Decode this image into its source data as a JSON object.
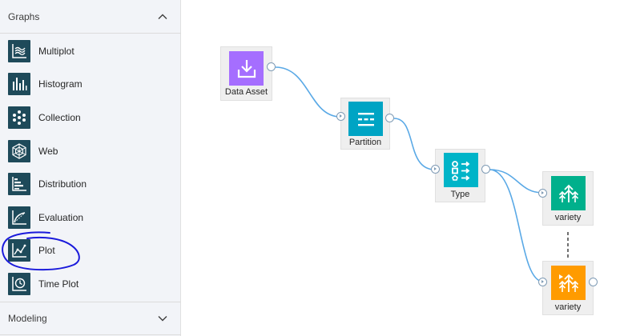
{
  "sidebar": {
    "graphs_section": {
      "label": "Graphs",
      "expanded": true
    },
    "items": [
      {
        "label": "Multiplot",
        "icon": "multiplot-icon"
      },
      {
        "label": "Histogram",
        "icon": "histogram-icon"
      },
      {
        "label": "Collection",
        "icon": "collection-icon"
      },
      {
        "label": "Web",
        "icon": "web-icon"
      },
      {
        "label": "Distribution",
        "icon": "distribution-icon"
      },
      {
        "label": "Evaluation",
        "icon": "evaluation-icon"
      },
      {
        "label": "Plot",
        "icon": "plot-icon"
      },
      {
        "label": "Time Plot",
        "icon": "time-plot-icon"
      }
    ],
    "modeling_section": {
      "label": "Modeling",
      "expanded": false
    }
  },
  "colors": {
    "sidebar_bg": "#f2f4f8",
    "palette_icon_bg": "#1e4a5a",
    "data_asset": "#a56eff",
    "partition": "#00a4c4",
    "type": "#00b4c8",
    "variety_model": "#00b08c",
    "variety_nugget": "#ff9b00",
    "link": "#5aa9e6",
    "annotation": "#1a1adb"
  },
  "canvas": {
    "nodes": [
      {
        "id": "data-asset",
        "label": "Data Asset",
        "icon": "download-icon"
      },
      {
        "id": "partition",
        "label": "Partition",
        "icon": "partition-icon"
      },
      {
        "id": "type",
        "label": "Type",
        "icon": "type-icon"
      },
      {
        "id": "variety-model",
        "label": "variety",
        "icon": "tree-model-icon"
      },
      {
        "id": "variety-nugget",
        "label": "variety",
        "icon": "tree-nugget-icon"
      }
    ]
  }
}
